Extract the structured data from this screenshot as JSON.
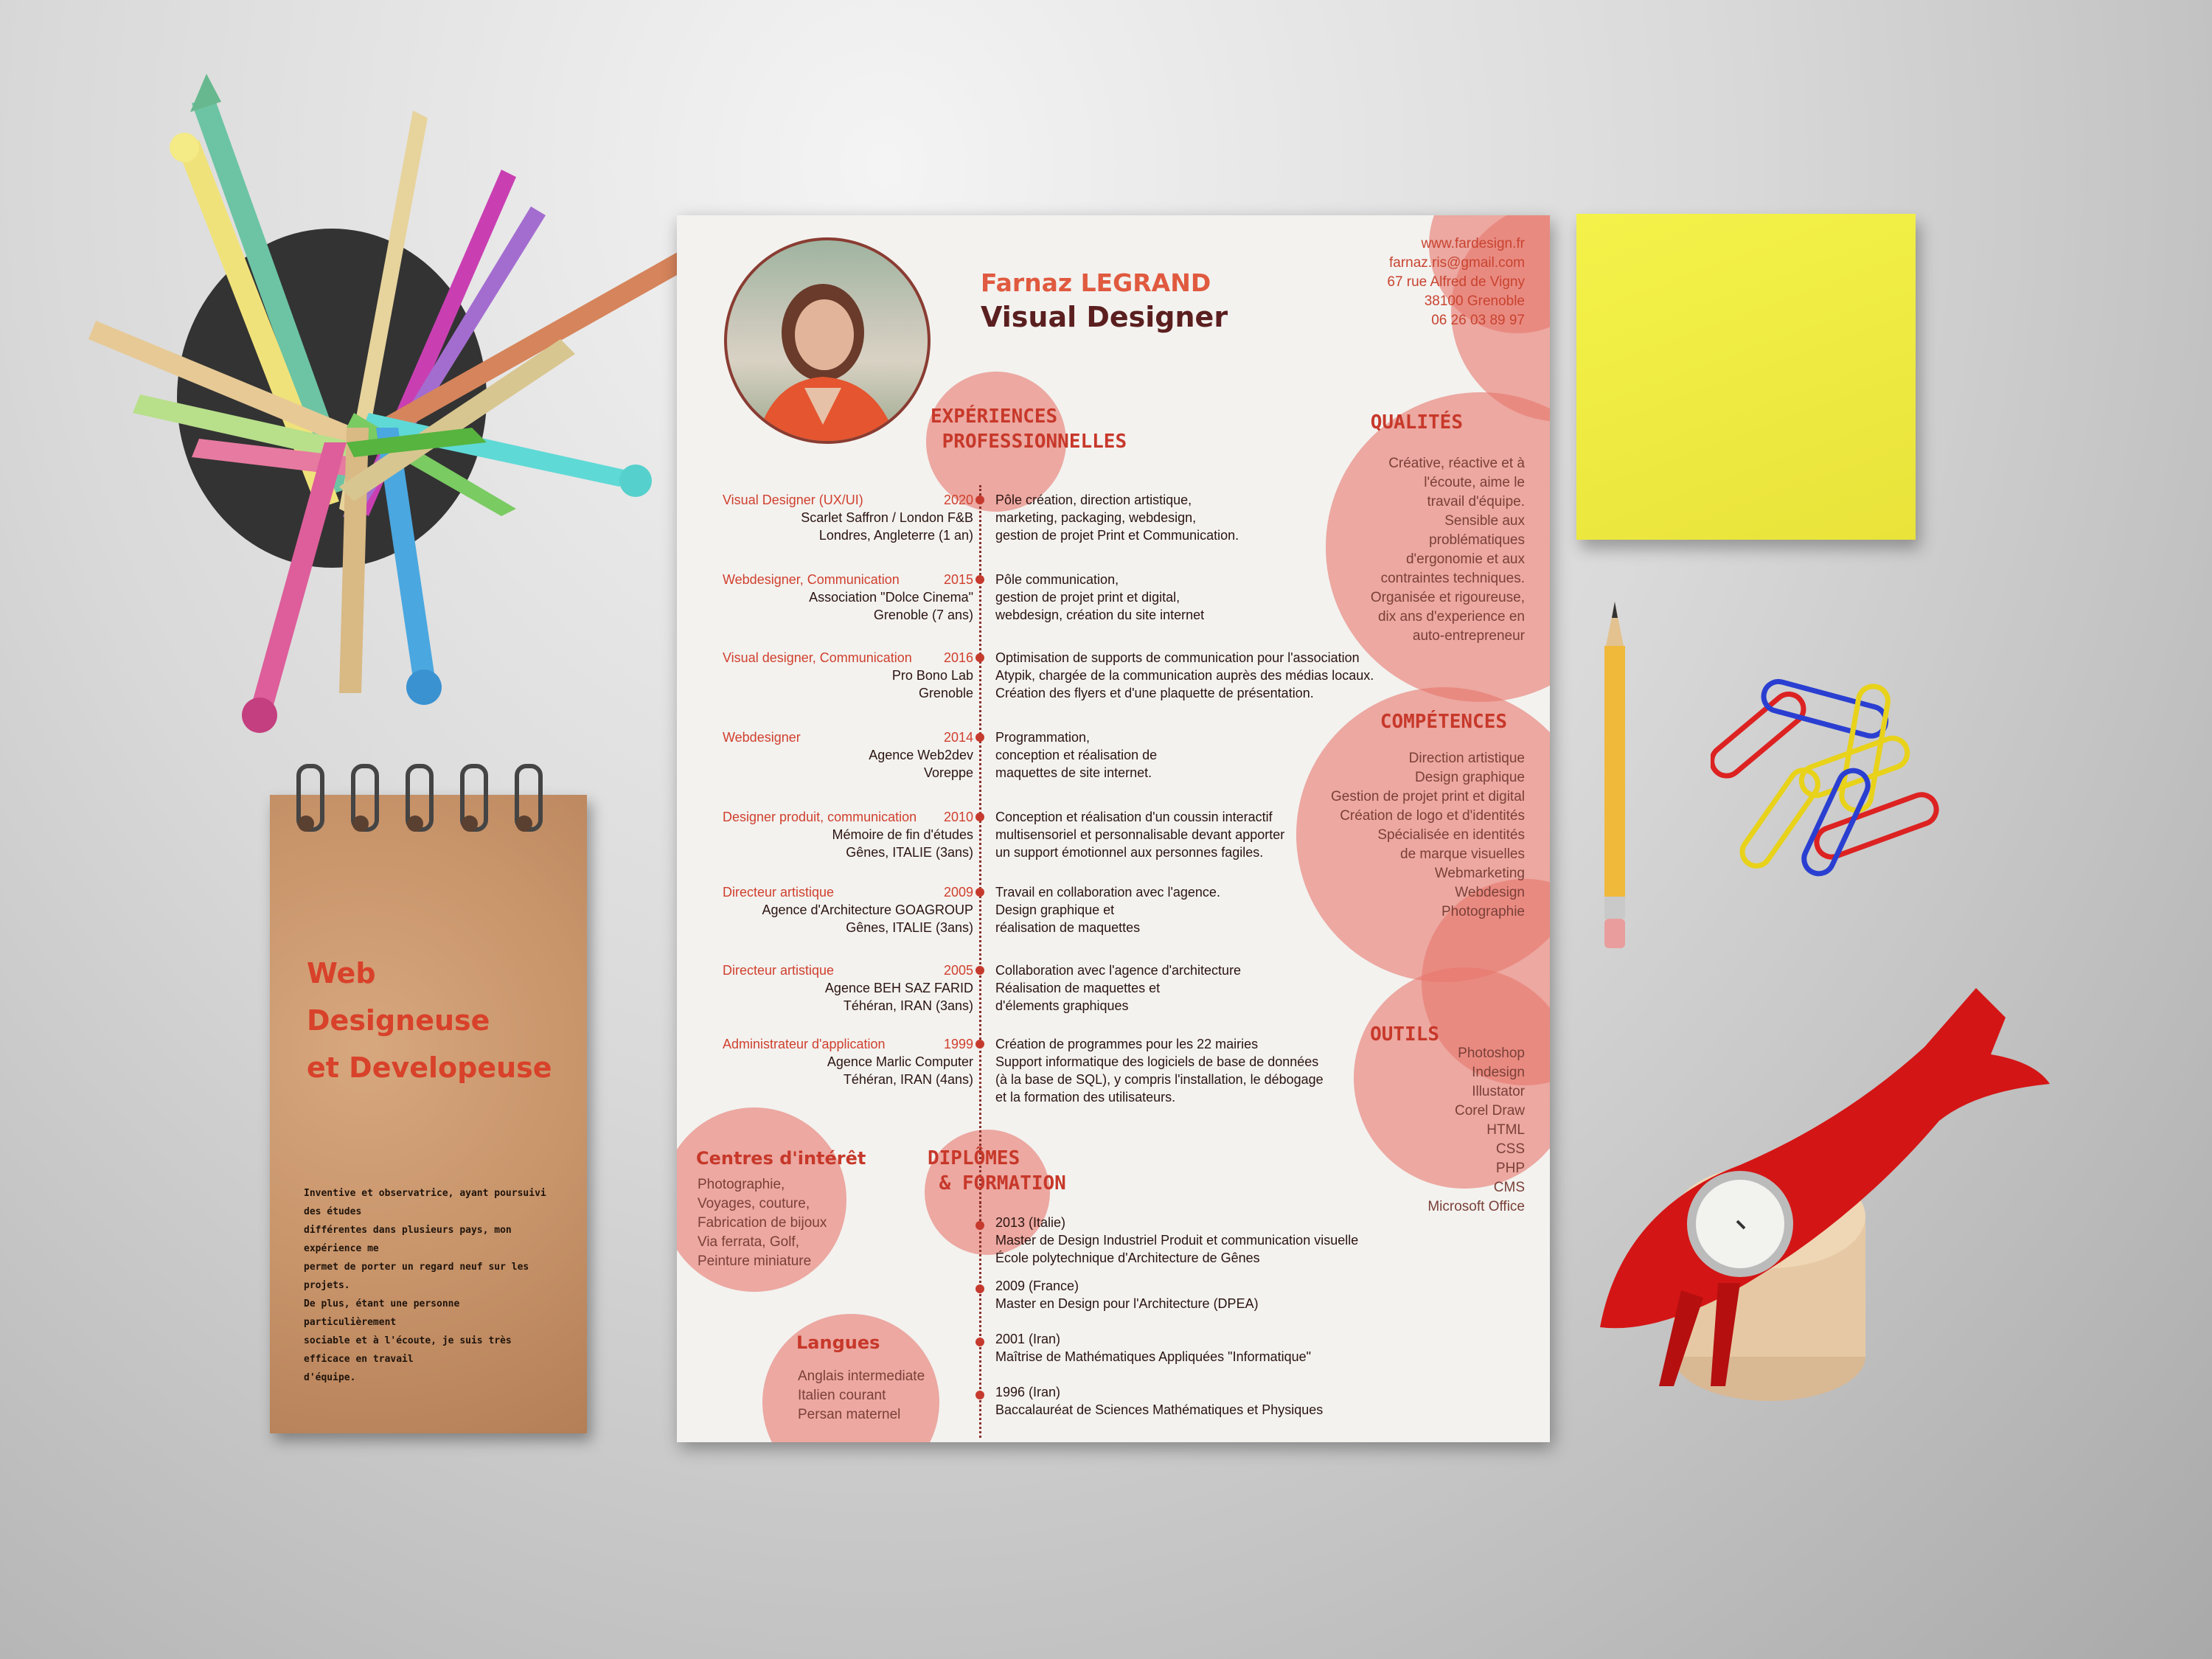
{
  "notepad": {
    "title": "Web\nDesigneuse\net Developeuse",
    "text_lines": [
      "Inventive et observatrice, ayant poursuivi des études",
      "différentes dans plusieurs pays, mon expérience me",
      "permet de porter un regard neuf sur les projets.",
      "De plus, étant une personne particulièrement",
      "sociable et à l'écoute, je suis très efficace en travail",
      "d'équipe."
    ]
  },
  "resume": {
    "name": "Farnaz LEGRAND",
    "title": "Visual Designer",
    "contact": {
      "website": "www.fardesign.fr",
      "email": "farnaz.ris@gmail.com",
      "address": "67 rue Alfred de Vigny",
      "city": "38100 Grenoble",
      "phone": "06 26 03 89 97"
    },
    "experience_title": "EXPÉRIENCES\n PROFESSIONNELLES",
    "experiences": [
      {
        "role": "Visual Designer (UX/UI)",
        "year": "2020",
        "where": "Scarlet Saffron / London F&B\nLondres, Angleterre (1 an)",
        "desc": "Pôle création, direction artistique,\nmarketing, packaging, webdesign,\ngestion de projet Print et Communication."
      },
      {
        "role": "Webdesigner, Communication",
        "year": "2015",
        "where": "Association \"Dolce Cinema\"\nGrenoble (7 ans)",
        "desc": "Pôle communication,\ngestion de projet print et digital,\nwebdesign, création du site internet"
      },
      {
        "role": "Visual designer, Communication",
        "year": "2016",
        "where": "Pro Bono Lab\nGrenoble",
        "desc": "Optimisation de supports de communication pour l'association\nAtypik, chargée de la communication auprès des médias locaux.\nCréation des flyers et d'une plaquette de présentation."
      },
      {
        "role": "Webdesigner",
        "year": "2014",
        "where": "Agence Web2dev\nVoreppe",
        "desc": "Programmation,\nconception et réalisation de\nmaquettes de site internet."
      },
      {
        "role": "Designer produit, communication",
        "year": "2010",
        "where": "Mémoire de fin d'études\nGênes, ITALIE (3ans)",
        "desc": "Conception et réalisation d'un coussin interactif\nmultisensoriel et personnalisable devant apporter\nun support émotionnel aux personnes fagiles."
      },
      {
        "role": "Directeur artistique",
        "year": "2009",
        "where": "Agence d'Architecture GOAGROUP\nGênes, ITALIE (3ans)",
        "desc": "Travail en collaboration avec l'agence.\nDesign graphique et\nréalisation de maquettes"
      },
      {
        "role": "Directeur artistique",
        "year": "2005",
        "where": "Agence BEH SAZ FARID\nTéhéran, IRAN (3ans)",
        "desc": "Collaboration avec l'agence d'architecture\nRéalisation de maquettes et\nd'élements graphiques"
      },
      {
        "role": "Administrateur d'application",
        "year": "1999",
        "where": "Agence Marlic Computer\nTéhéran, IRAN (4ans)",
        "desc": "Création de programmes pour les 22 mairies\nSupport informatique des logiciels de base de données\n(à la base de SQL), y compris l'installation, le débogage\net la formation des utilisateurs."
      }
    ],
    "qualites_title": "QUALITÉS",
    "qualites_text": "Créative, réactive et à\nl'écoute, aime le\ntravail d'équipe.\nSensible aux\nproblématiques\nd'ergonomie et aux\ncontraintes techniques.\nOrganisée et rigoureuse,\ndix ans d'experience en\nauto-entrepreneur",
    "competences_title": "COMPÉTENCES",
    "competences_text": "Direction artistique\nDesign graphique\nGestion de projet print et digital\nCréation de logo et d'identités\nSpécialisée en identités\nde marque visuelles\nWebmarketing\nWebdesign\nPhotographie",
    "outils_title": "OUTILS",
    "outils_text": "Photoshop\nIndesign\nIllustator\nCorel Draw\nHTML\nCSS\nPHP\nCMS\nMicrosoft Office",
    "interets_title": "Centres d'intérêt",
    "interets_text": "Photographie,\nVoyages, couture,\nFabrication de bijoux\nVia ferrata, Golf,\nPeinture miniature",
    "langues_title": "Langues",
    "langues_text": "Anglais intermediate\nItalien courant\nPersan maternel",
    "diplomes_title": "DIPLÔMES\n & FORMATION",
    "diplomes": [
      "2013 (Italie)\nMaster de Design Industriel Produit et communication visuelle\nÉcole polytechnique d'Architecture de Gênes",
      "2009 (France)\nMaster en Design pour l'Architecture (DPEA)",
      "2001 (Iran)\nMaîtrise de Mathématiques Appliquées \"Informatique\"",
      "1996 (Iran)\nBaccalauréat de Sciences Mathématiques et Physiques"
    ]
  },
  "colors": {
    "accent": "#e05a3f",
    "dark_title": "#5b1f1f",
    "circle": "#e8776c",
    "sticky": "#eee83f",
    "kraft": "#c8946a"
  },
  "icons": [
    "pencil-cup-illustration",
    "pencil-icon",
    "paperclips-icon",
    "candle-fish-holder-icon"
  ]
}
